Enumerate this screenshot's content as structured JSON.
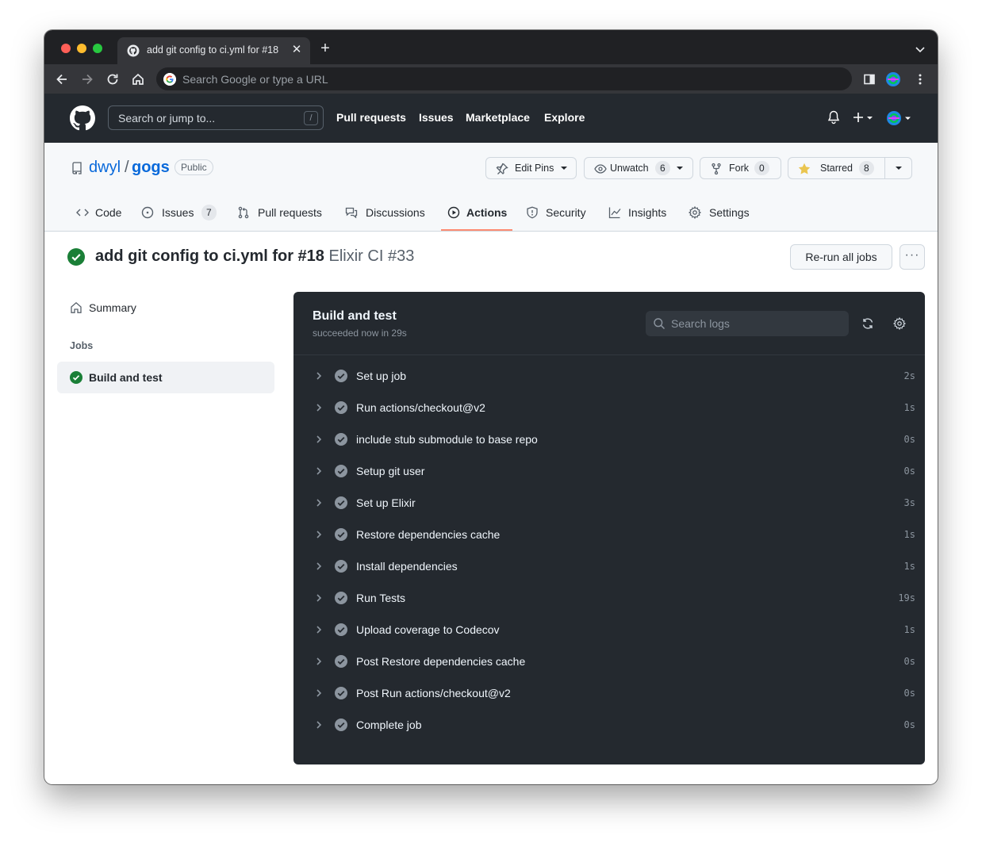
{
  "browser": {
    "tab_title": "add git config to ci.yml for #18",
    "omnibox_placeholder": "Search Google or type a URL"
  },
  "header": {
    "search_placeholder": "Search or jump to...",
    "search_shortcut": "/",
    "nav": [
      "Pull requests",
      "Issues",
      "Marketplace",
      "Explore"
    ]
  },
  "repo": {
    "owner": "dwyl",
    "separator": "/",
    "name": "gogs",
    "visibility": "Public",
    "edit_pins": "Edit Pins",
    "unwatch_label": "Unwatch",
    "unwatch_count": "6",
    "fork_label": "Fork",
    "fork_count": "0",
    "starred_label": "Starred",
    "starred_count": "8"
  },
  "repo_tabs": {
    "code": "Code",
    "issues": "Issues",
    "issues_count": "7",
    "pull_requests": "Pull requests",
    "discussions": "Discussions",
    "actions": "Actions",
    "security": "Security",
    "insights": "Insights",
    "settings": "Settings",
    "active": "Actions"
  },
  "run": {
    "title": "add git config to ci.yml for #18",
    "workflow": "Elixir CI #33",
    "rerun_label": "Re-run all jobs",
    "more_label": "···"
  },
  "sidebar": {
    "summary": "Summary",
    "jobs_heading": "Jobs",
    "job_name": "Build and test"
  },
  "job": {
    "title": "Build and test",
    "status": "succeeded now in 29s",
    "search_placeholder": "Search logs",
    "steps": [
      {
        "name": "Set up job",
        "duration": "2s"
      },
      {
        "name": "Run actions/checkout@v2",
        "duration": "1s"
      },
      {
        "name": "include stub submodule to base repo",
        "duration": "0s"
      },
      {
        "name": "Setup git user",
        "duration": "0s"
      },
      {
        "name": "Set up Elixir",
        "duration": "3s"
      },
      {
        "name": "Restore dependencies cache",
        "duration": "1s"
      },
      {
        "name": "Install dependencies",
        "duration": "1s"
      },
      {
        "name": "Run Tests",
        "duration": "19s"
      },
      {
        "name": "Upload coverage to Codecov",
        "duration": "1s"
      },
      {
        "name": "Post Restore dependencies cache",
        "duration": "0s"
      },
      {
        "name": "Post Run actions/checkout@v2",
        "duration": "0s"
      },
      {
        "name": "Complete job",
        "duration": "0s"
      }
    ]
  },
  "colors": {
    "success": "#1a7f37",
    "link": "#0969da",
    "header_bg": "#24292f",
    "log_bg": "#24292f",
    "tab_underline": "#fd8c73"
  }
}
